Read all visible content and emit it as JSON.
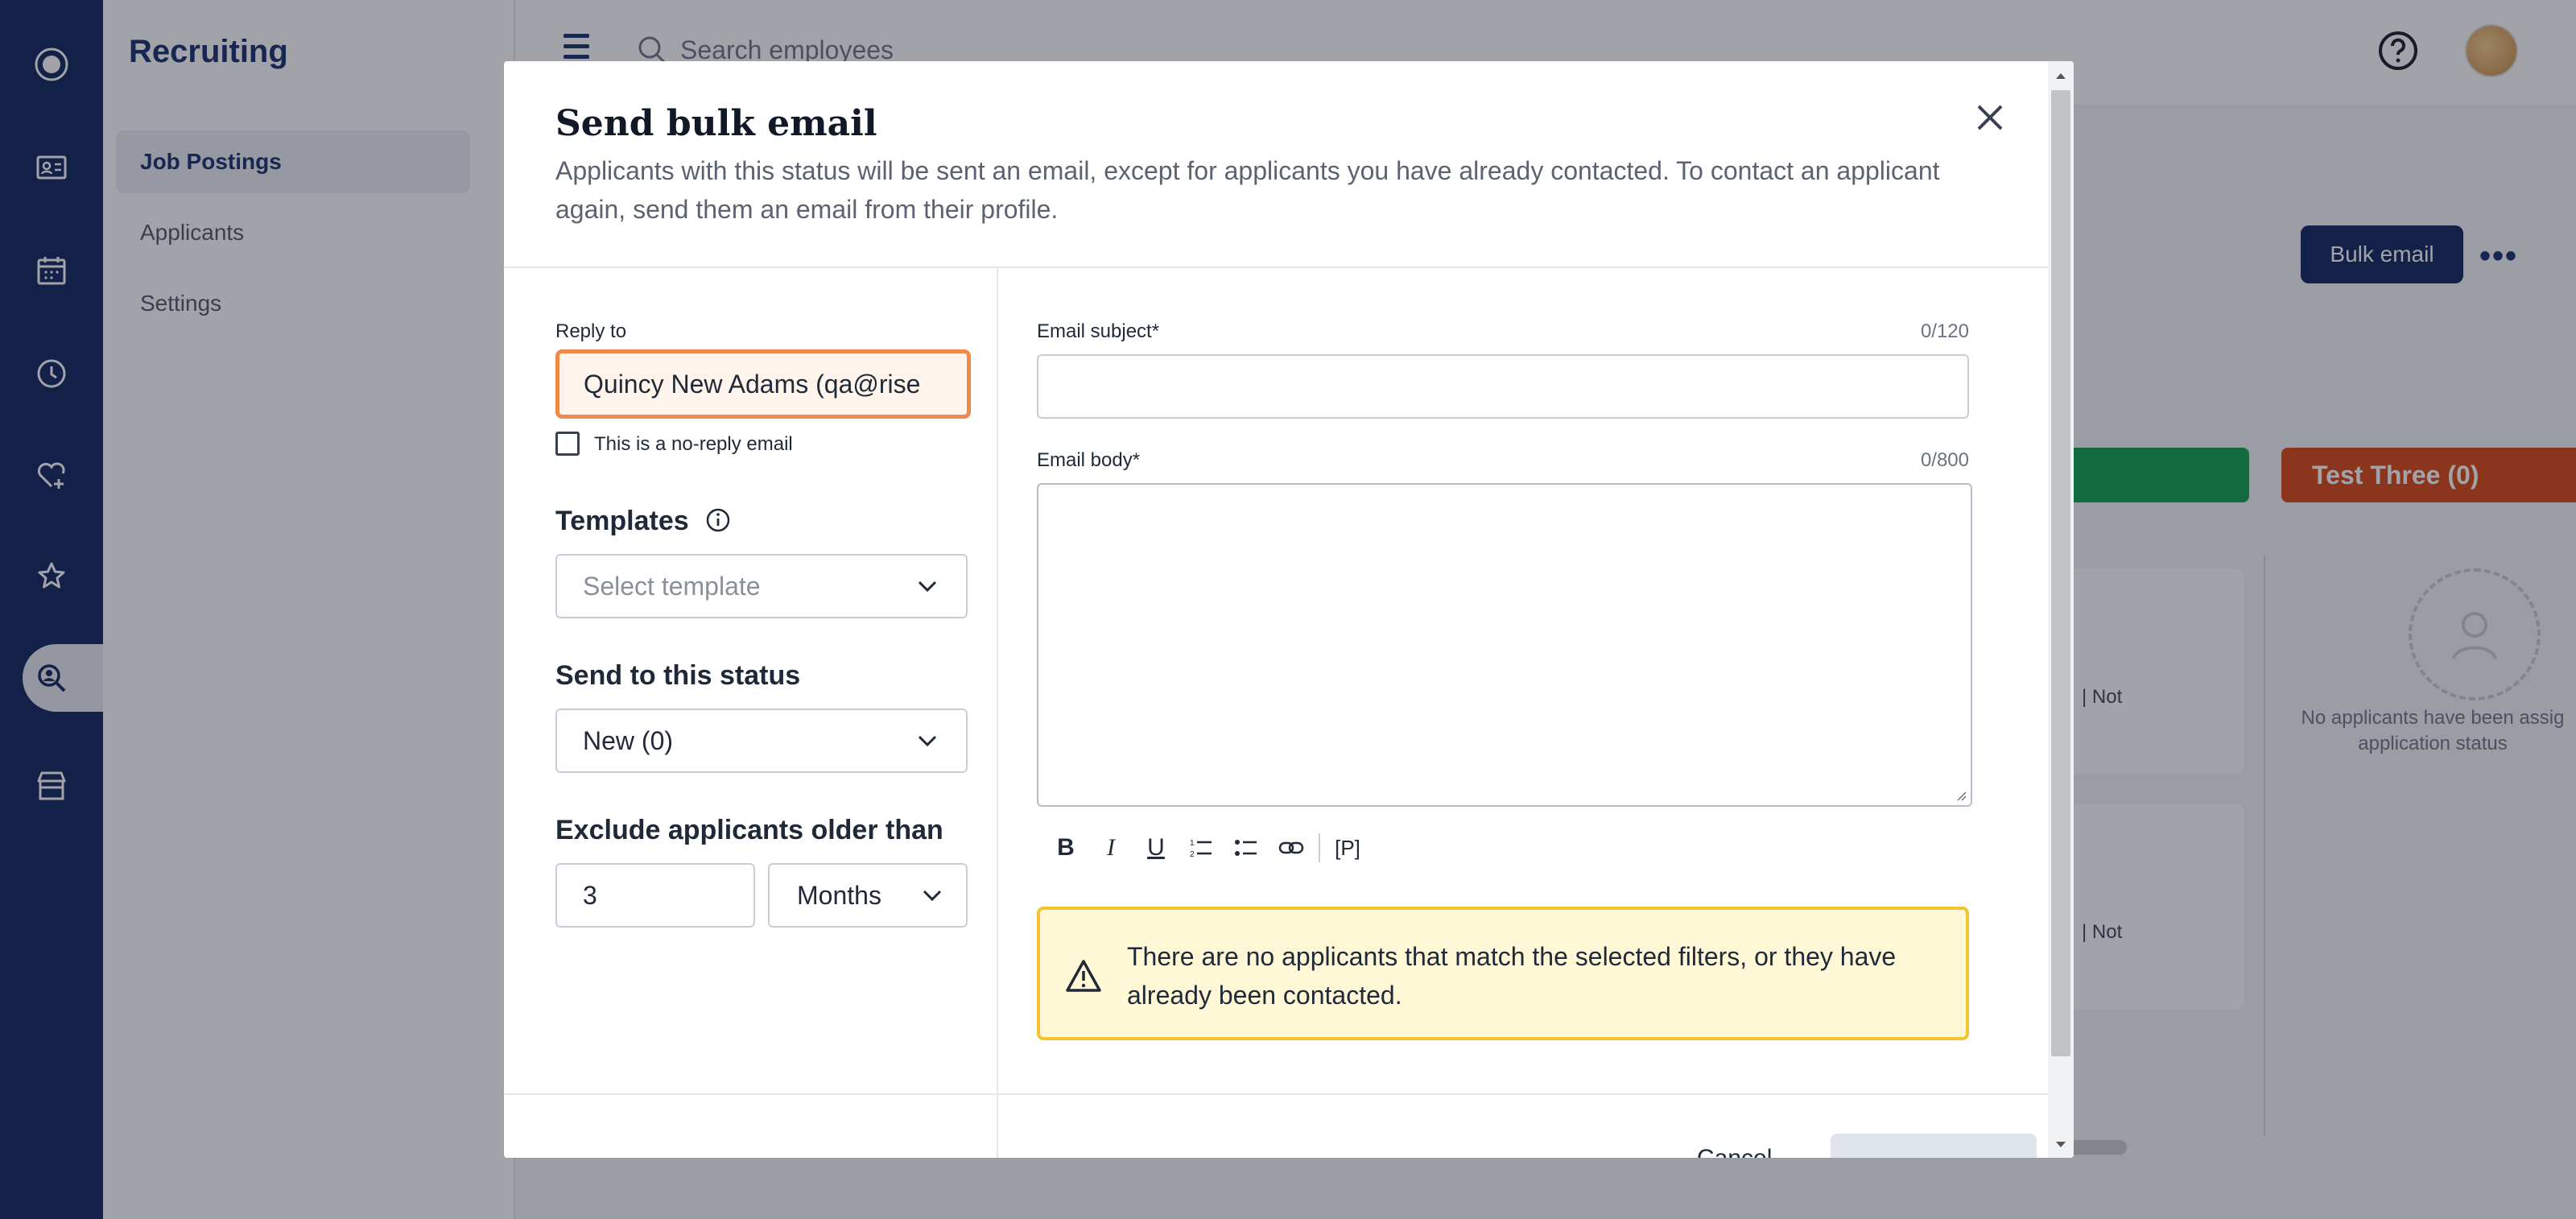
{
  "app": {
    "section_title": "Recruiting",
    "search_placeholder": "Search employees"
  },
  "sidebar": {
    "items": [
      {
        "label": "Job Postings",
        "active": true
      },
      {
        "label": "Applicants",
        "active": false
      },
      {
        "label": "Settings",
        "active": false
      }
    ]
  },
  "rail_icons": [
    "logo-icon",
    "employee-card-icon",
    "calendar-icon",
    "clock-icon",
    "heart-plus-icon",
    "star-badge-icon",
    "recruiting-search-icon",
    "store-icon"
  ],
  "background": {
    "bulk_email_label": "Bulk email",
    "status_red_label": "Test Three (0)",
    "card_text": "| Not",
    "empty_text": "No applicants have been assig application status"
  },
  "modal": {
    "title": "Send bulk email",
    "description": "Applicants with this status will be sent an email, except for applicants you have already contacted. To contact an applicant again, send them an email from their profile.",
    "reply_to_label": "Reply to",
    "reply_to_value": "Quincy New Adams (qa@rise",
    "no_reply_label": "This is a no-reply email",
    "no_reply_checked": false,
    "templates_label": "Templates",
    "template_placeholder": "Select template",
    "status_label": "Send to this status",
    "status_value": "New (0)",
    "exclude_label": "Exclude applicants older than",
    "exclude_number": "3",
    "exclude_unit": "Months",
    "subject_label": "Email subject*",
    "subject_counter": "0/120",
    "body_label": "Email body*",
    "body_counter": "0/800",
    "toolbar": [
      "B",
      "I",
      "U",
      "ordered-list",
      "bullet-list",
      "link",
      "[P]"
    ],
    "alert_text": "There are no applicants that match the selected filters, or they have already been contacted.",
    "cancel_label": "Cancel"
  },
  "colors": {
    "rail": "#0c1e5b",
    "accent_orange": "#f08a4b",
    "alert_bg": "#fff7d6",
    "alert_border": "#f4c430",
    "status_green": "#0a9f4a",
    "status_red": "#d9420f"
  }
}
